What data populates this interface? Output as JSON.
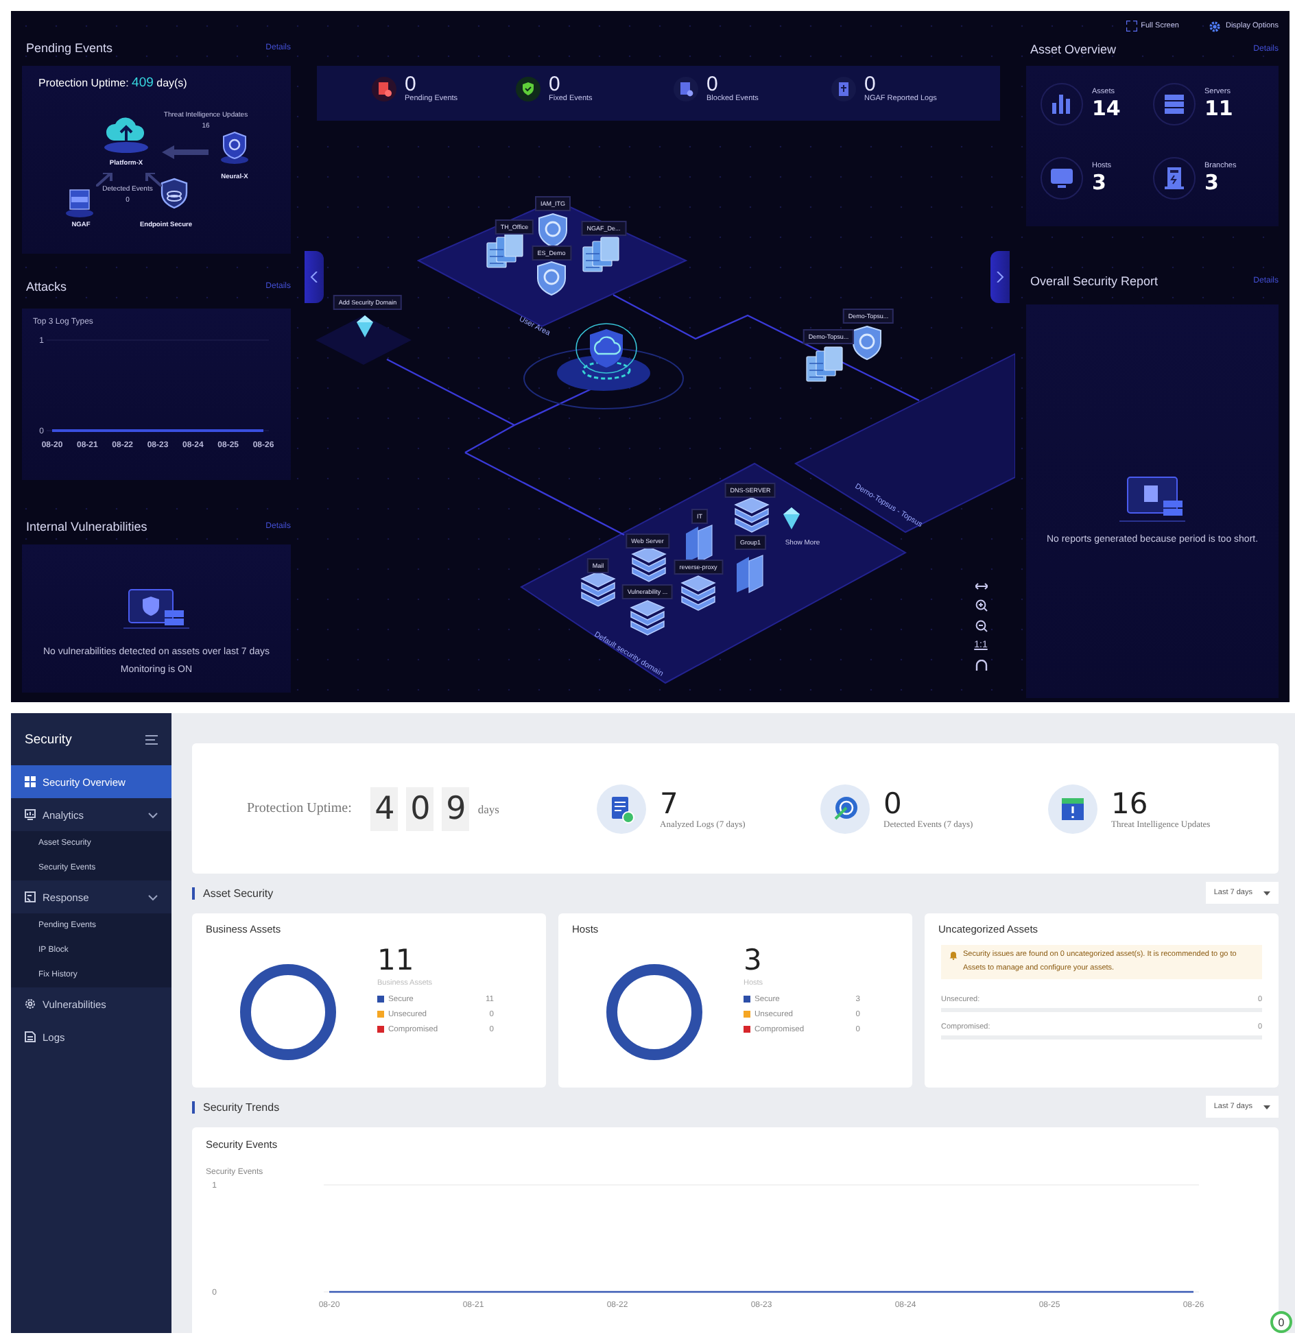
{
  "dashboard": {
    "toolbar": [
      {
        "kind": "fullscreen",
        "label": "Full Screen"
      },
      {
        "kind": "display",
        "label": "Display Options"
      }
    ],
    "pending_events": {
      "title": "Pending Events",
      "details": "Details",
      "uptime_label": "Protection Uptime:",
      "uptime_value": "409",
      "uptime_unit": "day(s)",
      "nodes": [
        {
          "label": "Platform-X"
        },
        {
          "label": "Neural-X"
        },
        {
          "label": "NGAF"
        },
        {
          "label": "Endpoint Secure"
        }
      ],
      "flows": [
        {
          "label": "Threat Intelligence Updates",
          "value": "16"
        },
        {
          "label": "Detected Events",
          "value": "0"
        }
      ]
    },
    "attacks": {
      "title": "Attacks",
      "details": "Details",
      "chart_data": {
        "type": "line",
        "title": "Top 3 Log Types",
        "categories": [
          "08-20",
          "08-21",
          "08-22",
          "08-23",
          "08-24",
          "08-25",
          "08-26"
        ],
        "series": [
          {
            "color": "#3a4fe0",
            "values": [
              0,
              0,
              0,
              0,
              0,
              0,
              0
            ]
          }
        ],
        "yticks": [
          0,
          1
        ],
        "ylim": [
          0,
          1
        ]
      }
    },
    "internal_vulnerabilities": {
      "title": "Internal Vulnerabilities",
      "details": "Details",
      "messages": [
        "No vulnerabilities detected on assets over last 7 days",
        "Monitoring is ON"
      ]
    },
    "event_stats": [
      {
        "value": "0",
        "label": "Pending Events"
      },
      {
        "value": "0",
        "label": "Fixed Events"
      },
      {
        "value": "0",
        "label": "Blocked Events"
      },
      {
        "value": "0",
        "label": "NGAF Reported Logs"
      }
    ],
    "map": {
      "nodes": [
        {
          "label": "TH_Office",
          "kind": "server"
        },
        {
          "label": "IAM_ITG",
          "kind": "shield"
        },
        {
          "label": "NGAF_De...",
          "kind": "server"
        },
        {
          "label": "ES_Demo",
          "kind": "shield"
        },
        {
          "label": "Add Security Domain",
          "kind": "gem"
        },
        {
          "label": "Demo-Topsu...",
          "kind": "shield"
        },
        {
          "label": "Demo-Topsu...",
          "kind": "server"
        },
        {
          "label": "DNS-SERVER",
          "kind": "stack"
        },
        {
          "label": "IT",
          "kind": "folder"
        },
        {
          "label": "Web Server",
          "kind": "stack"
        },
        {
          "label": "Group1",
          "kind": "folder"
        },
        {
          "label": "Show More",
          "kind": "more"
        },
        {
          "label": "Mail",
          "kind": "stack"
        },
        {
          "label": "reverse-proxy",
          "kind": "stack"
        },
        {
          "label": "Vulnerability ...",
          "kind": "stack"
        }
      ],
      "areas": [
        "User Area",
        "Default security domain",
        "Demo-Topsus - Topsus"
      ],
      "controls": [
        {
          "kind": "fit"
        },
        {
          "kind": "zoom-in"
        },
        {
          "kind": "zoom-out"
        },
        {
          "kind": "actual",
          "label": "1:1"
        },
        {
          "kind": "reset"
        }
      ]
    },
    "asset_overview": {
      "title": "Asset Overview",
      "details": "Details",
      "items": [
        {
          "label": "Assets",
          "value": "14"
        },
        {
          "label": "Servers",
          "value": "11"
        },
        {
          "label": "Hosts",
          "value": "3"
        },
        {
          "label": "Branches",
          "value": "3"
        }
      ]
    },
    "security_report": {
      "title": "Overall Security Report",
      "details": "Details",
      "message": "No reports generated because period is too short."
    }
  },
  "sidebar": {
    "title": "Security",
    "items": [
      {
        "label": "Security Overview",
        "selected": true
      },
      {
        "label": "Analytics",
        "selected": false,
        "expanded": true,
        "children": [
          {
            "label": "Asset Security",
            "selected": false
          },
          {
            "label": "Security Events",
            "selected": false
          }
        ]
      },
      {
        "label": "Response",
        "selected": false,
        "expanded": true,
        "children": [
          {
            "label": "Pending Events",
            "selected": false
          },
          {
            "label": "IP Block",
            "selected": false
          },
          {
            "label": "Fix History",
            "selected": false
          }
        ]
      },
      {
        "label": "Vulnerabilities",
        "selected": false
      },
      {
        "label": "Logs",
        "selected": false
      }
    ]
  },
  "overview": {
    "uptime": {
      "label": "Protection Uptime:",
      "digits": [
        "4",
        "0",
        "9"
      ],
      "unit": "days"
    },
    "stats": [
      {
        "value": "7",
        "label": "Analyzed Logs (7 days)"
      },
      {
        "value": "0",
        "label": "Detected Events (7 days)"
      },
      {
        "value": "16",
        "label": "Threat Intelligence Updates"
      }
    ],
    "asset_security": {
      "title": "Asset Security",
      "range": "Last 7 days",
      "cards": [
        {
          "kind": "donut",
          "title": "Business Assets",
          "total": "11",
          "caption": "Business Assets",
          "legend": [
            {
              "label": "Secure",
              "value": "11",
              "color": "#2d4fa8"
            },
            {
              "label": "Unsecured",
              "value": "0",
              "color": "#f5a623"
            },
            {
              "label": "Compromised",
              "value": "0",
              "color": "#d7262b"
            }
          ]
        },
        {
          "kind": "donut",
          "title": "Hosts",
          "total": "3",
          "caption": "Hosts",
          "legend": [
            {
              "label": "Secure",
              "value": "3",
              "color": "#2d4fa8"
            },
            {
              "label": "Unsecured",
              "value": "0",
              "color": "#f5a623"
            },
            {
              "label": "Compromised",
              "value": "0",
              "color": "#d7262b"
            }
          ]
        },
        {
          "kind": "list",
          "title": "Uncategorized Assets",
          "notice": "Security issues are found on 0 uncategorized asset(s). It is recommended to go to Assets to manage and configure your assets.",
          "rows": [
            {
              "label": "Unsecured:",
              "value": "0"
            },
            {
              "label": "Compromised:",
              "value": "0"
            }
          ]
        }
      ]
    },
    "security_trends": {
      "title": "Security Trends",
      "range": "Last 7 days",
      "card_title": "Security Events",
      "chart_data": {
        "type": "line",
        "ylabel": "Security Events",
        "categories": [
          "08-20",
          "08-21",
          "08-22",
          "08-23",
          "08-24",
          "08-25",
          "08-26"
        ],
        "series": [
          {
            "color": "#3b5bb5",
            "values": [
              0,
              0,
              0,
              0,
              0,
              0,
              0
            ]
          }
        ],
        "yticks": [
          0,
          1
        ],
        "ylim": [
          0,
          1
        ]
      }
    },
    "floating_badge": "0"
  }
}
